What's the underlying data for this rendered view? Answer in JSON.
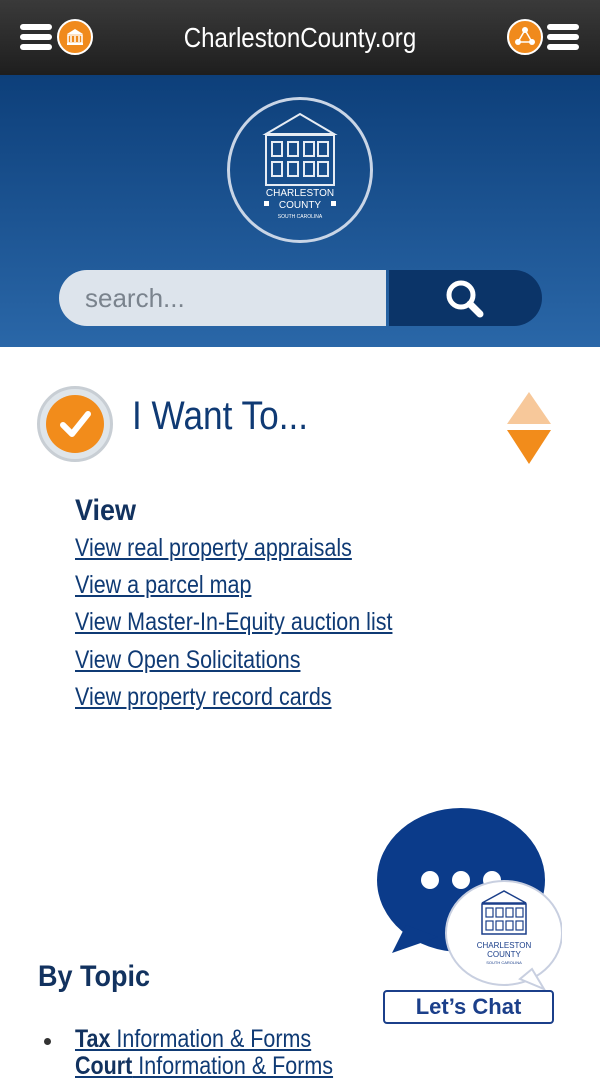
{
  "header": {
    "site_title": "CharlestonCounty.org",
    "left_menu_icon": "menu-icon",
    "left_circle_icon": "courthouse-icon",
    "right_circle_icon": "share-icon",
    "right_menu_icon": "menu-icon",
    "bar_color": "#2b2b2b"
  },
  "hero": {
    "seal_line1": "CHARLESTON",
    "seal_line2": "COUNTY",
    "seal_line3": "SOUTH CAROLINA",
    "search_placeholder": "search...",
    "search_icon": "search-icon",
    "bg_color": "#1b4f90"
  },
  "want": {
    "title": "I Want To...",
    "badge_icon": "checkmark-icon",
    "toggle_icon": "up-down-arrows-icon",
    "accent": "#f28c1b",
    "section": "View",
    "links": [
      "View real property appraisals",
      "View a parcel map",
      "View Master-In-Equity auction list",
      "View Open Solicitations",
      "View property record cards"
    ]
  },
  "topics": {
    "heading": "By Topic",
    "items": [
      {
        "bold": "Tax",
        "rest": " Information & Forms"
      },
      {
        "bold": "Court",
        "rest": " Information & Forms"
      }
    ]
  },
  "chat": {
    "label": "Let’s Chat",
    "seal_line1": "CHARLESTON",
    "seal_line2": "COUNTY",
    "seal_line3": "SOUTH CAROLINA"
  }
}
